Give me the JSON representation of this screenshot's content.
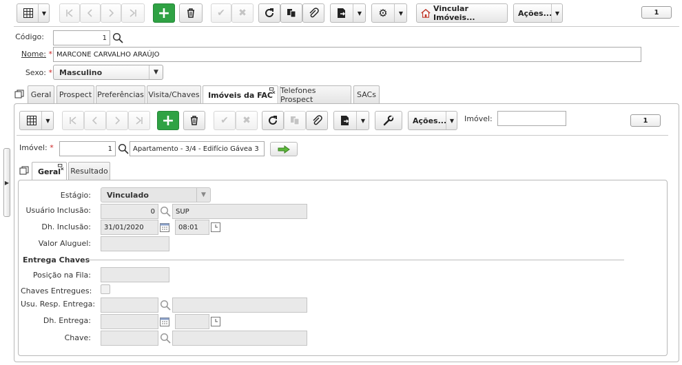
{
  "toolbar": {
    "vincular_label": "Vincular Imóveis...",
    "acoes_label": "Ações...",
    "page_number": "1"
  },
  "form": {
    "codigo_label": "Código:",
    "codigo_value": "1",
    "nome_label": "Nome:",
    "nome_value": "MARCONE CARVALHO ARAÚJO",
    "sexo_label": "Sexo:",
    "sexo_value": "Masculino",
    "required_mark": "*"
  },
  "main_tabs": [
    {
      "label": "Geral"
    },
    {
      "label": "Prospect"
    },
    {
      "label": "Preferências"
    },
    {
      "label": "Visita/Chaves"
    },
    {
      "label": "Imóveis da FAC"
    },
    {
      "label": "Telefones Prospect"
    },
    {
      "label": "SACs"
    }
  ],
  "sub_toolbar": {
    "acoes_label": "Ações...",
    "imovel_filter_label": "Imóvel:",
    "imovel_filter_value": "",
    "page_number": "1"
  },
  "imovel": {
    "label": "Imóvel:",
    "code": "1",
    "description": "Apartamento - 3/4 - Edifício Gávea 3"
  },
  "sub_tabs": [
    {
      "label": "Geral"
    },
    {
      "label": "Resultado"
    }
  ],
  "detail": {
    "estagio_label": "Estágio:",
    "estagio_value": "Vinculado",
    "usuario_inclusao_label": "Usuário Inclusão:",
    "usuario_inclusao_code": "0",
    "usuario_inclusao_name": "SUP",
    "dh_inclusao_label": "Dh. Inclusão:",
    "dh_inclusao_date": "31/01/2020",
    "dh_inclusao_time": "08:01",
    "valor_aluguel_label": "Valor Aluguel:",
    "entrega_section": "Entrega Chaves",
    "posicao_fila_label": "Posição na Fila:",
    "chaves_entregues_label": "Chaves Entregues:",
    "usu_resp_entrega_label": "Usu. Resp. Entrega:",
    "dh_entrega_label": "Dh. Entrega:",
    "chave_label": "Chave:"
  }
}
